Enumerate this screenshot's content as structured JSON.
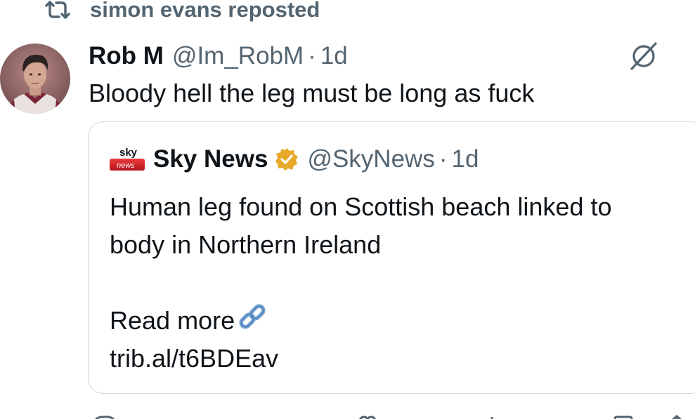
{
  "repost": {
    "icon": "repost-icon",
    "text": "simon evans reposted"
  },
  "tweet": {
    "author_name": "Rob M",
    "author_handle": "@Im_RobM",
    "separator": "·",
    "time": "1d",
    "text": "Bloody hell the leg must be long as fuck",
    "grok_icon": "grok-slash-icon"
  },
  "quote": {
    "logo_text_top": "sky",
    "logo_text_bottom": "news",
    "name": "Sky News",
    "verified_icon": "verified-gold-badge-icon",
    "handle": "@SkyNews",
    "separator": "·",
    "time": "1d",
    "body_line1": "Human leg found on Scottish beach linked to",
    "body_line2": "body in Northern Ireland",
    "read_more": "Read more",
    "link_emoji": "link-icon",
    "link_url": "trib.al/t6BDEav"
  },
  "colors": {
    "primary_text": "#0f1419",
    "secondary_text": "#536471",
    "border": "#cfd9de",
    "verified_gold": "#e8a92a",
    "sky_red": "#d1232a",
    "link_blue": "#7aa6d6"
  }
}
